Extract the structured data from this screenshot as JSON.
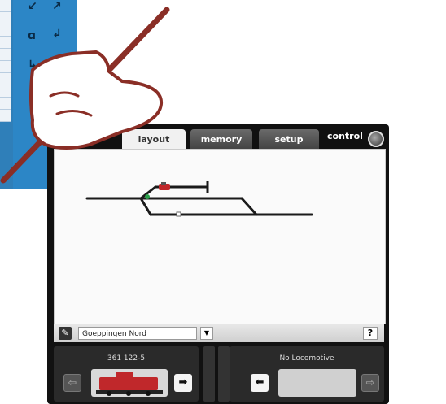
{
  "background": {
    "tile_glyphs": [
      "↙",
      "↗",
      "ɑ",
      "↲",
      "↳"
    ]
  },
  "tabs": [
    {
      "label": "layout",
      "state": "active"
    },
    {
      "label": "memory",
      "state": "inactive"
    },
    {
      "label": "setup",
      "state": "inactive"
    }
  ],
  "control": {
    "label": "control"
  },
  "toolbar": {
    "station": "Goeppingen Nord",
    "help_label": "?",
    "dropdown_glyph": "▼",
    "wrench_glyph": "✎"
  },
  "locomotives": {
    "left": {
      "name": "361 122-5",
      "prev_glyph": "⇦",
      "next_glyph": "➡"
    },
    "right": {
      "name": "No Locomotive",
      "prev_glyph": "⬅",
      "next_glyph": "⇨"
    }
  },
  "colors": {
    "track": "#1a1a1a",
    "loco_body": "#c0282b",
    "pen": "#8a2e26"
  }
}
